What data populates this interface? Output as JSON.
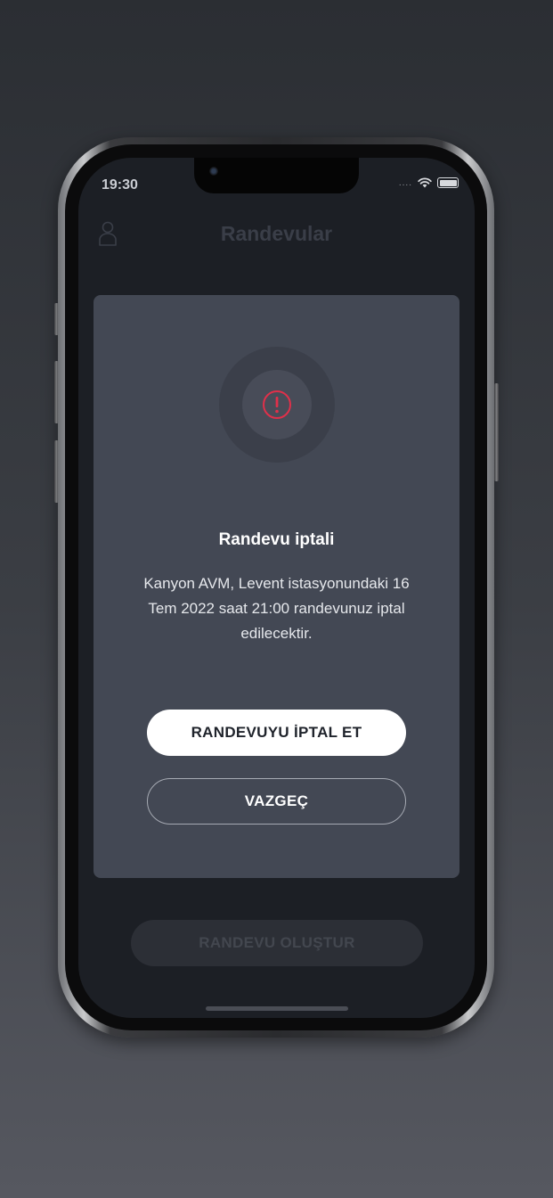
{
  "status_bar": {
    "time": "19:30",
    "signal": "....",
    "icons": [
      "wifi-icon",
      "battery-icon"
    ]
  },
  "header": {
    "title": "Randevular",
    "left_icon": "user-icon"
  },
  "main": {
    "create_button_label": "RANDEVU OLUŞTUR"
  },
  "modal": {
    "icon": "alert-circle-icon",
    "title": "Randevu iptali",
    "message": "Kanyon AVM, Levent istasyonundaki 16 Tem 2022 saat 21:00 randevunuz iptal edilecektir.",
    "confirm_label": "RANDEVUYU İPTAL ET",
    "cancel_label": "VAZGEÇ"
  },
  "colors": {
    "accent_alert": "#e0304a",
    "modal_bg": "#434854",
    "screen_bg": "#1c1f25"
  }
}
